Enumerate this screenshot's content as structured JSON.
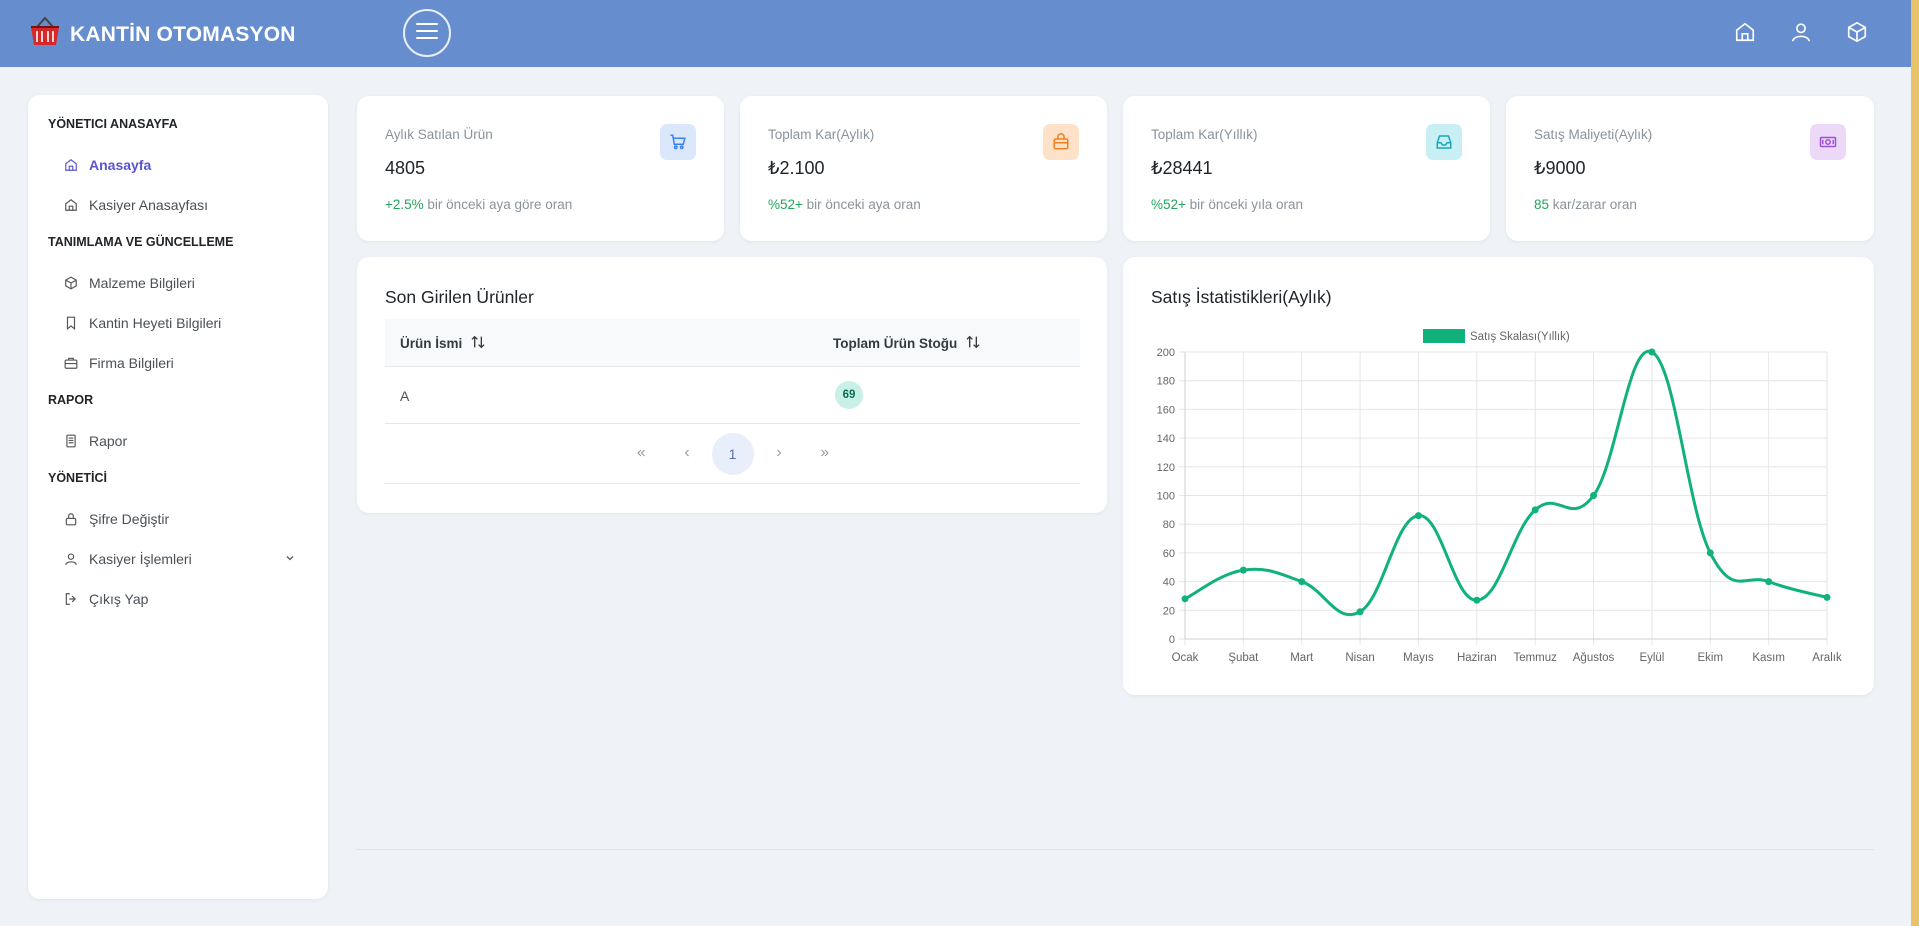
{
  "app": {
    "title": "KANTİN OTOMASYON"
  },
  "topbar": {
    "icons": [
      "home-icon",
      "user-icon",
      "box-icon"
    ]
  },
  "sidebar": {
    "sections": [
      {
        "title": "YÖNETICI ANASAYFA",
        "items": [
          {
            "label": "Anasayfa",
            "icon": "home-icon",
            "active": true
          },
          {
            "label": "Kasiyer Anasayfası",
            "icon": "home-icon"
          }
        ]
      },
      {
        "title": "TANIMLAMA VE GÜNCELLEME",
        "items": [
          {
            "label": "Malzeme Bilgileri",
            "icon": "box-icon"
          },
          {
            "label": "Kantin Heyeti Bilgileri",
            "icon": "bookmark-icon"
          },
          {
            "label": "Firma Bilgileri",
            "icon": "briefcase-icon"
          }
        ]
      },
      {
        "title": "RAPOR",
        "items": [
          {
            "label": "Rapor",
            "icon": "report-icon"
          }
        ]
      },
      {
        "title": "YÖNETİCİ",
        "items": [
          {
            "label": "Şifre Değiştir",
            "icon": "lock-icon"
          },
          {
            "label": "Kasiyer İşlemleri",
            "icon": "user-icon",
            "expandable": true
          },
          {
            "label": "Çıkış Yap",
            "icon": "logout-icon"
          }
        ]
      }
    ]
  },
  "stats": [
    {
      "title": "Aylık Satılan Ürün",
      "value": "4805",
      "delta": "+2.5%",
      "foot": "bir önceki aya göre oran",
      "icon": "cart-icon",
      "bg": "#dbe7fb",
      "fg": "#3b82f6"
    },
    {
      "title": "Toplam Kar(Aylık)",
      "value": "₺2.100",
      "delta": "%52+",
      "foot": "bir önceki aya oran",
      "icon": "bag-icon",
      "bg": "#fde2c9",
      "fg": "#f07f22"
    },
    {
      "title": "Toplam Kar(Yıllık)",
      "value": "₺28441",
      "delta": "%52+",
      "foot": "bir önceki yıla oran",
      "icon": "inbox-icon",
      "bg": "#c8eff3",
      "fg": "#1aa7b8"
    },
    {
      "title": "Satış Maliyeti(Aylık)",
      "value": "₺9000",
      "delta": "85",
      "foot": "kar/zarar oran",
      "icon": "money-icon",
      "bg": "#ecd9f7",
      "fg": "#a052d6"
    }
  ],
  "products": {
    "title": "Son Girilen Ürünler",
    "columns": [
      "Ürün İsmi",
      "Toplam Ürün Stoğu"
    ],
    "rows": [
      {
        "name": "A",
        "stock": "69"
      }
    ],
    "pager": {
      "first": "«",
      "prev": "‹",
      "current": "1",
      "next": "›",
      "last": "»"
    }
  },
  "chart_data": {
    "type": "line",
    "title": "Satış İstatistikleri(Aylık)",
    "categories": [
      "Ocak",
      "Şubat",
      "Mart",
      "Nisan",
      "Mayıs",
      "Haziran",
      "Temmuz",
      "Ağustos",
      "Eylül",
      "Ekim",
      "Kasım",
      "Aralık"
    ],
    "series": [
      {
        "name": "Satış Skalası(Yıllık)",
        "values": [
          28,
          48,
          40,
          19,
          86,
          27,
          90,
          100,
          200,
          60,
          40,
          29
        ],
        "color": "#10b27a"
      }
    ],
    "ylim": [
      0,
      200
    ],
    "yticks": [
      0,
      20,
      40,
      60,
      80,
      100,
      120,
      140,
      160,
      180,
      200
    ],
    "grid": true,
    "legend": "top-center"
  }
}
